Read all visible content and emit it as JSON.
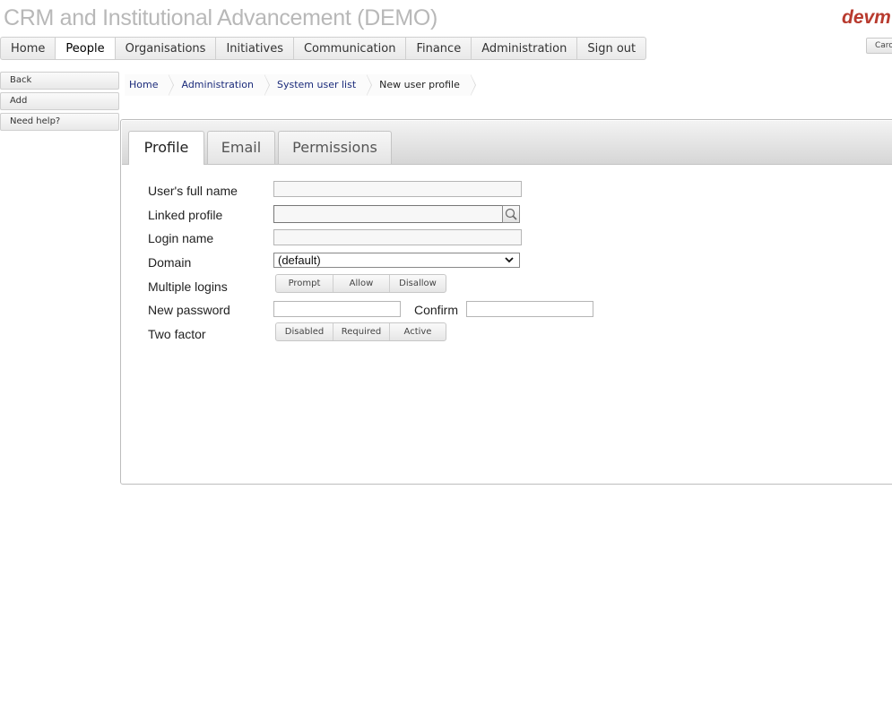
{
  "header": {
    "app_title": "CRM and Institutional Advancement (DEMO)",
    "brand": "devm",
    "user_button": "Caro"
  },
  "nav": {
    "tabs": [
      {
        "label": "Home"
      },
      {
        "label": "People",
        "active": true
      },
      {
        "label": "Organisations"
      },
      {
        "label": "Initiatives"
      },
      {
        "label": "Communication"
      },
      {
        "label": "Finance"
      },
      {
        "label": "Administration"
      },
      {
        "label": "Sign out"
      }
    ]
  },
  "sidebar": {
    "items": [
      {
        "label": "Back"
      },
      {
        "label": "Add"
      },
      {
        "label": "Need help?"
      }
    ]
  },
  "breadcrumb": {
    "items": [
      {
        "label": "Home"
      },
      {
        "label": "Administration"
      },
      {
        "label": "System user list"
      },
      {
        "label": "New user profile"
      }
    ]
  },
  "panel": {
    "tabs": [
      {
        "label": "Profile",
        "active": true
      },
      {
        "label": "Email"
      },
      {
        "label": "Permissions"
      }
    ]
  },
  "form": {
    "full_name": {
      "label": "User's full name",
      "value": ""
    },
    "linked_profile": {
      "label": "Linked profile",
      "value": "",
      "button_icon": "magnifier-icon"
    },
    "login_name": {
      "label": "Login name",
      "value": ""
    },
    "domain": {
      "label": "Domain",
      "selected": "(default)"
    },
    "multiple_logins": {
      "label": "Multiple logins",
      "options": [
        "Prompt",
        "Allow",
        "Disallow"
      ]
    },
    "new_password": {
      "label": "New password",
      "value": ""
    },
    "confirm": {
      "label": "Confirm",
      "value": ""
    },
    "two_factor": {
      "label": "Two factor",
      "options": [
        "Disabled",
        "Required",
        "Active"
      ]
    }
  }
}
